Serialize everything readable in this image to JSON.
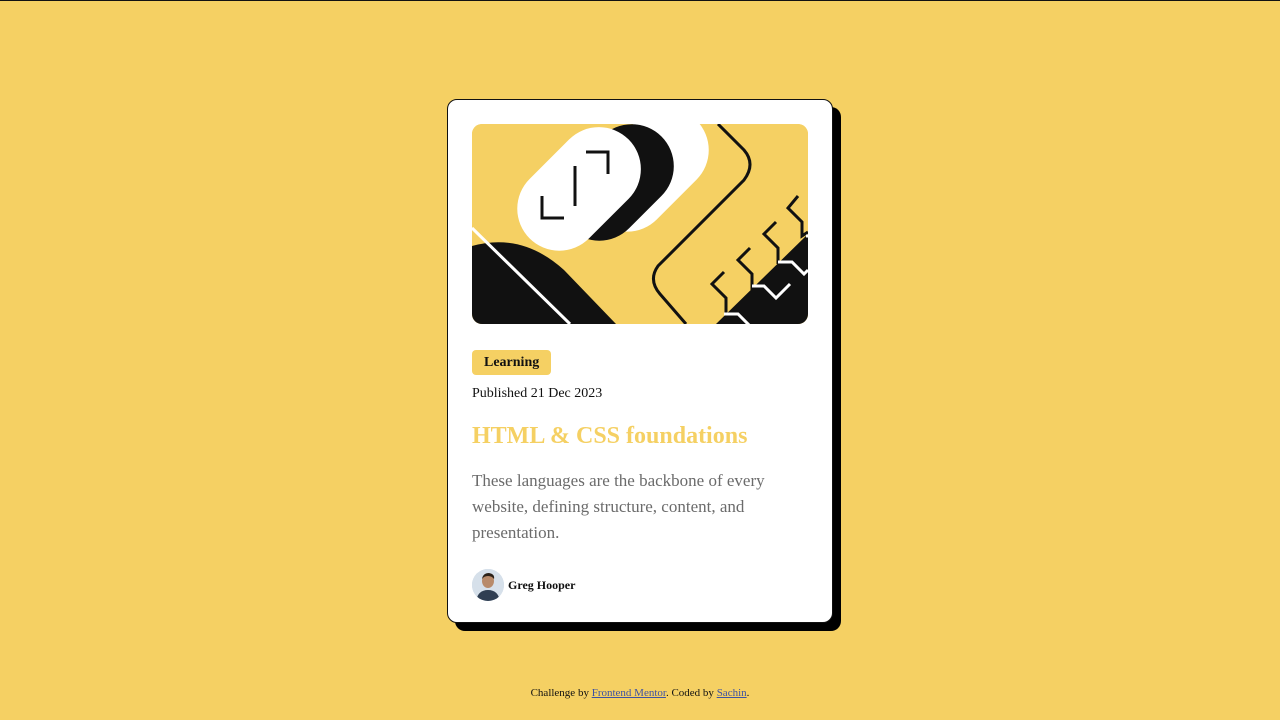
{
  "colors": {
    "background": "#f5d063",
    "card": "#ffffff",
    "text": "#111111",
    "muted": "#6b6b6b",
    "link": "#3e52a3"
  },
  "card": {
    "image_icon": "abstract-illustration",
    "tag": "Learning",
    "published": "Published 21 Dec 2023",
    "title": "HTML & CSS foundations",
    "description": "These languages are the backbone of every website, defining structure, content, and presentation.",
    "author": {
      "name": "Greg Hooper",
      "avatar_icon": "avatar-photo"
    }
  },
  "footer": {
    "prefix": "Challenge by ",
    "link1": "Frontend Mentor",
    "middle": ". Coded by ",
    "link2": "Sachin",
    "suffix": "."
  }
}
